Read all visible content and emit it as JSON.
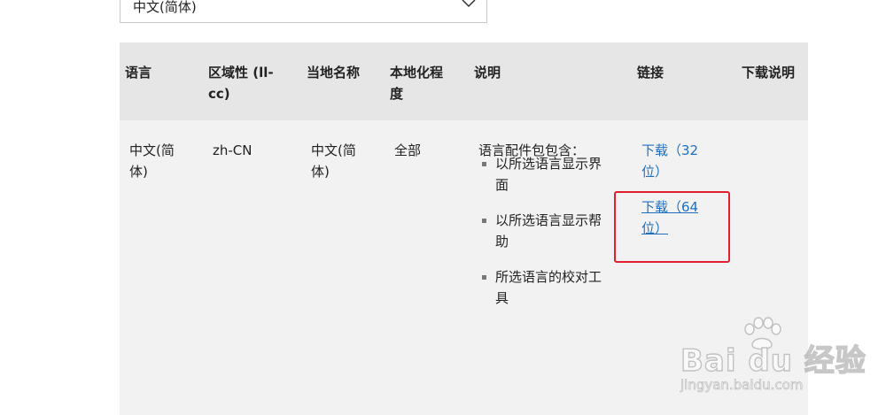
{
  "language_select": {
    "value": "中文(简体)",
    "icon": "chevron-down-icon"
  },
  "table": {
    "headers": {
      "language": "语言",
      "locale_line1": "区域性 (ll-",
      "locale_line2": "cc)",
      "native_name": "当地名称",
      "localization_line1": "本地化程",
      "localization_line2": "度",
      "description": "说明",
      "links": "链接",
      "download_notes": "下载说明"
    },
    "row": {
      "language_line1": "中文(简",
      "language_line2": "体)",
      "locale": "zh-CN",
      "native_line1": "中文(简",
      "native_line2": "体)",
      "localization": "全部",
      "description_intro": "语言配件包包含：",
      "description_items": [
        {
          "line1": "以所选语言显示界",
          "line2": "面"
        },
        {
          "line1": "以所选语言显示帮",
          "line2": "助"
        },
        {
          "line1": "所选语言的校对工",
          "line2": "具"
        }
      ],
      "link_32_line1": "下载（32",
      "link_32_line2": "位）",
      "link_64_line1": "下载（64",
      "link_64_line2": "位）"
    }
  },
  "annotation": {
    "color": "#e0202e"
  },
  "watermark": {
    "text": "Bai du 经验",
    "sub": "jingyan.baidu.com"
  },
  "colors": {
    "link": "#1f6fc0",
    "header_bg": "#e6e6e6",
    "row_bg": "#f2f2f2"
  }
}
